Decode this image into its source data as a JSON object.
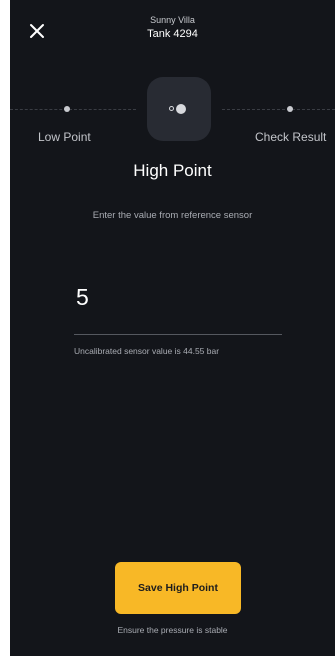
{
  "header": {
    "site_name": "Sunny Villa",
    "tank_name": "Tank 4294"
  },
  "icons": {
    "close": "close-icon"
  },
  "stepper": {
    "steps": [
      {
        "label": "Low Point",
        "state": "completed"
      },
      {
        "label": "High Point",
        "state": "active"
      },
      {
        "label": "Check Result",
        "state": "pending"
      }
    ]
  },
  "main": {
    "title": "High Point",
    "instruction": "Enter the value from reference sensor",
    "input_value": "5",
    "helper_text": "Uncalibrated sensor value is 44.55 bar"
  },
  "footer": {
    "save_label": "Save High Point",
    "note": "Ensure the pressure is stable"
  },
  "colors": {
    "background": "#13151a",
    "step_box": "#282b33",
    "accent": "#f8b826",
    "text_primary": "#ffffff",
    "text_secondary": "#a9acb3"
  }
}
